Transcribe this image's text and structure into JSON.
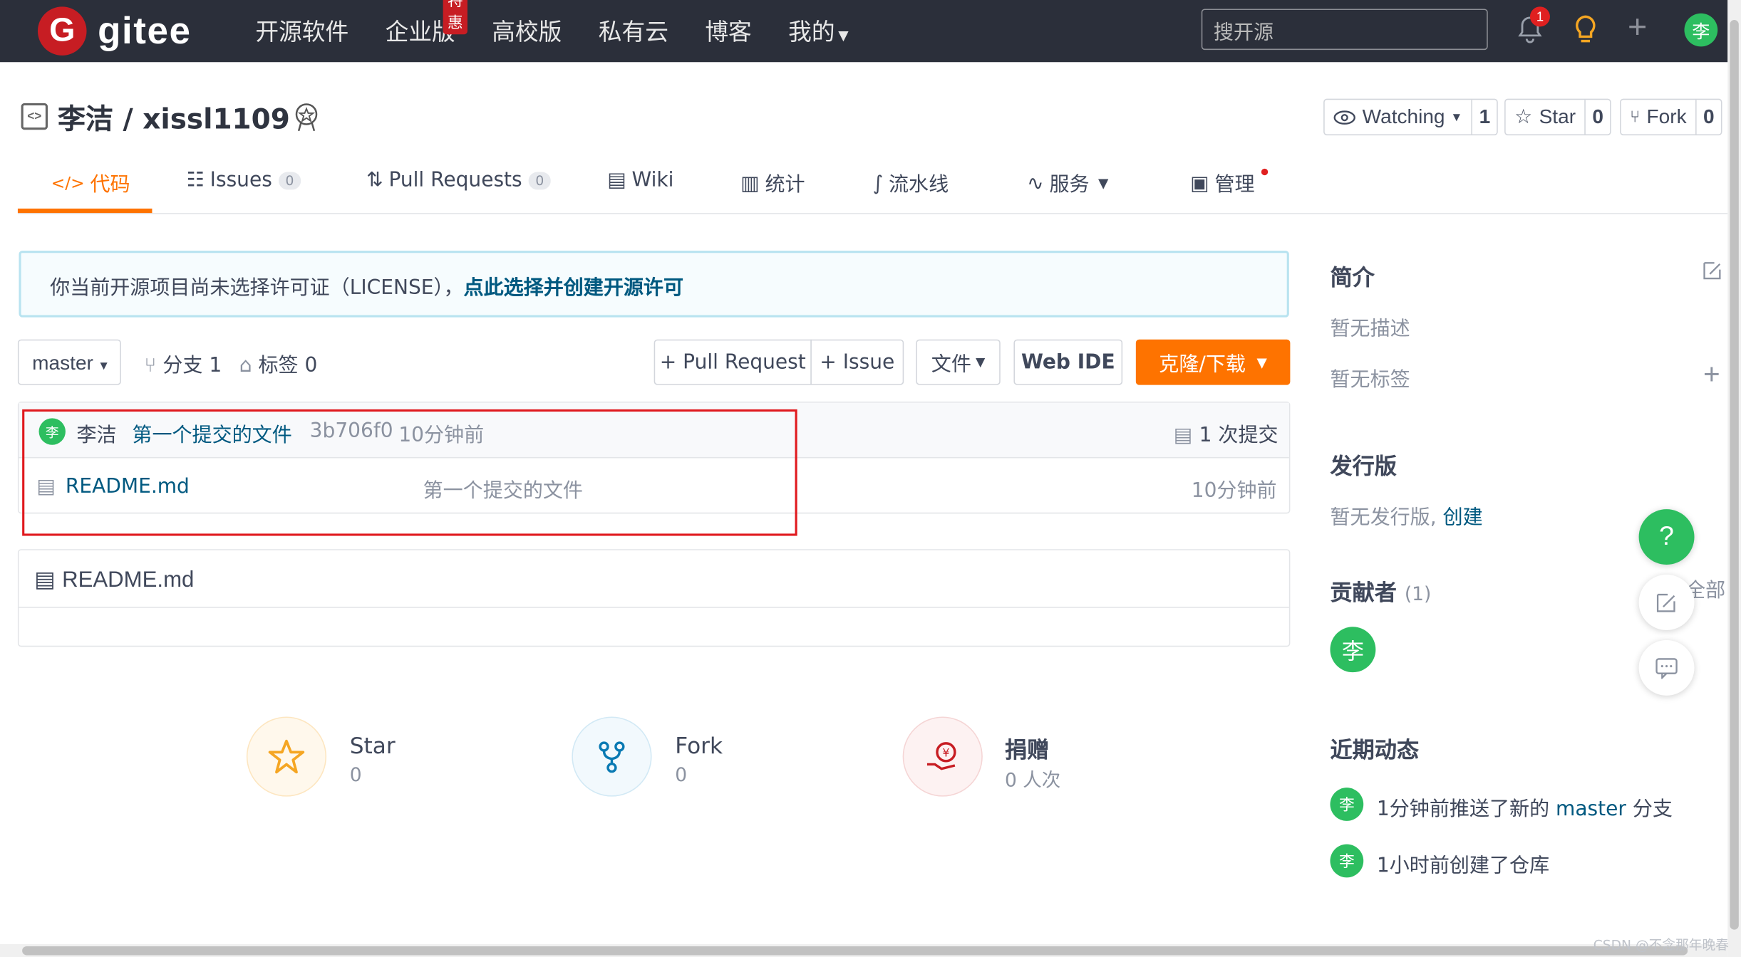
{
  "nav": {
    "logo_letter": "G",
    "logo_text": "gitee",
    "links": [
      "开源软件",
      "企业版",
      "高校版",
      "私有云",
      "博客",
      "我的"
    ],
    "enterprise_badge": "特惠",
    "search_placeholder": "搜开源",
    "notif_count": "1",
    "avatar": "李"
  },
  "repo": {
    "title": "李洁 / xissl1109",
    "watching_label": "Watching",
    "watching_count": "1",
    "star_label": "Star",
    "star_count": "0",
    "fork_label": "Fork",
    "fork_count": "0"
  },
  "tabs": {
    "code": "代码",
    "issues": "Issues",
    "issues_count": "0",
    "pulls": "Pull Requests",
    "pulls_count": "0",
    "wiki": "Wiki",
    "stats": "统计",
    "pipeline": "流水线",
    "services": "服务",
    "manage": "管理"
  },
  "notice": {
    "text": "你当前开源项目尚未选择许可证（LICENSE），",
    "link": "点此选择并创建开源许可"
  },
  "branch": {
    "name": "master",
    "branches": "分支 1",
    "tags": "标签 0",
    "pr_button": "+ Pull Request",
    "issue_button": "+ Issue",
    "file_button": "文件",
    "webide_button": "Web IDE",
    "clone_button": "克隆/下载"
  },
  "commit": {
    "avatar": "李",
    "author": "李洁",
    "message": "第一个提交的文件",
    "hash": "3b706f0",
    "time": "10分钟前",
    "count": "1 次提交"
  },
  "files": [
    {
      "name": "README.md",
      "message": "第一个提交的文件",
      "time": "10分钟前"
    }
  ],
  "readme": {
    "title": "README.md"
  },
  "stats": {
    "star_title": "Star",
    "star_value": "0",
    "fork_title": "Fork",
    "fork_value": "0",
    "donate_title": "捐赠",
    "donate_value": "0 人次"
  },
  "sidebar": {
    "intro_title": "简介",
    "no_desc": "暂无描述",
    "no_tags": "暂无标签",
    "release_title": "发行版",
    "no_release": "暂无发行版,",
    "create_link": "创建",
    "contrib_title": "贡献者",
    "contrib_count": "(1)",
    "contrib_all": "全部",
    "contrib_avatar": "李",
    "activity_title": "近期动态",
    "activities": [
      {
        "avatar": "李",
        "text_pre": "1分钟前推送了新的 ",
        "branch": "master",
        "text_post": " 分支"
      },
      {
        "avatar": "李",
        "text": "1小时前创建了仓库"
      }
    ]
  },
  "watermark": "CSDN @不念那年晚春",
  "colors": {
    "brand": "#c71d23",
    "accent": "#fe7300",
    "link": "#005980",
    "avatar": "#2dbe60",
    "highlight": "#e0191e"
  }
}
